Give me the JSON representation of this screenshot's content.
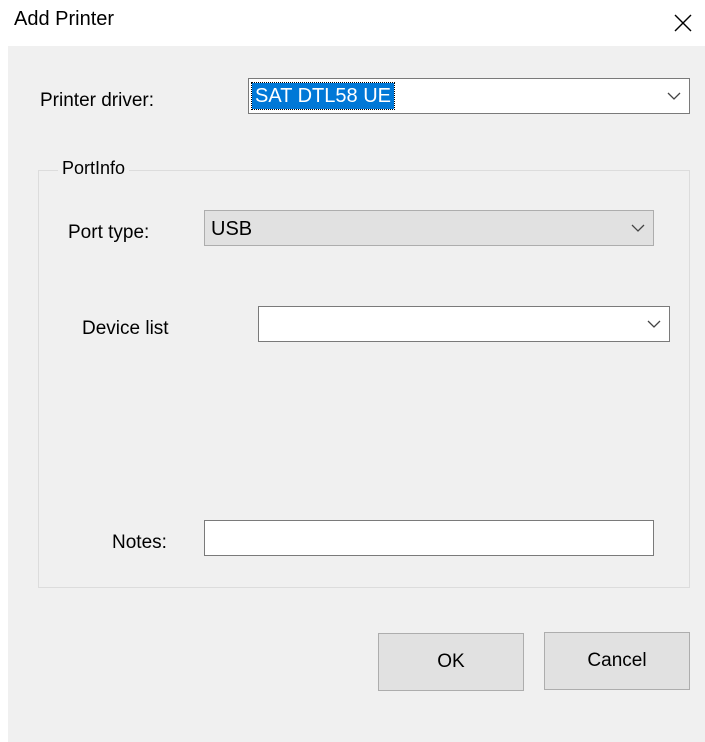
{
  "window": {
    "title": "Add Printer"
  },
  "printer_driver": {
    "label": "Printer driver:",
    "value": "SAT DTL58 UE"
  },
  "port_info": {
    "group_title": "PortInfo",
    "port_type": {
      "label": "Port type:",
      "value": "USB"
    },
    "device_list": {
      "label": "Device list",
      "value": ""
    },
    "notes": {
      "label": "Notes:",
      "value": ""
    }
  },
  "buttons": {
    "ok_label": "OK",
    "cancel_label": "Cancel"
  },
  "icons": {
    "close": "close-icon",
    "dropdown": "chevron-down-icon"
  },
  "colors": {
    "selection": "#0078d7",
    "dialog_background": "#f0f0f0",
    "button_face": "#e1e1e1"
  }
}
